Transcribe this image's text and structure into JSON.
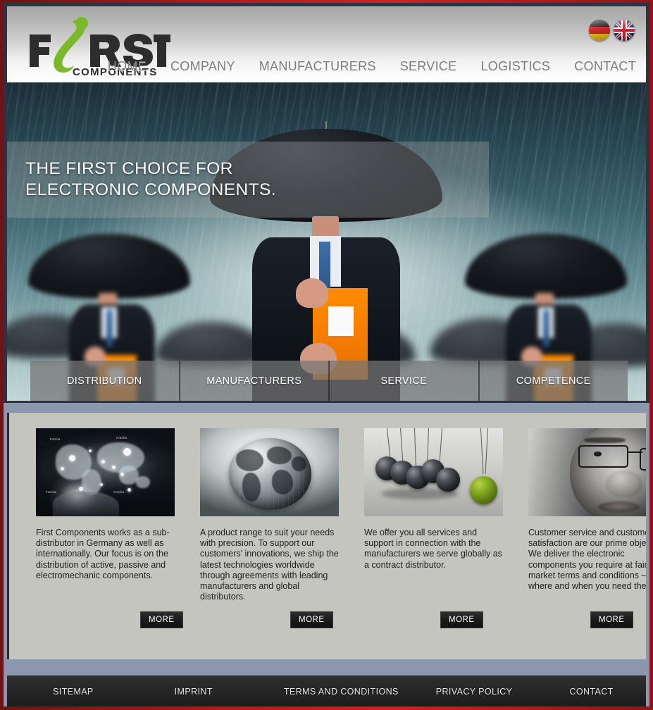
{
  "site": {
    "logo_main": "FIRST",
    "logo_sub": "COMPONENTS",
    "accent_green": "#7ab929",
    "frame_red": "#b31b1b",
    "hero_band_gray": "#aaaeac",
    "content_bg": "#c5c5bf",
    "footer_bg": "#242424",
    "page_bg_blue": "#8a97ad"
  },
  "language_flags": [
    {
      "name": "german-flag",
      "label": "Deutsch",
      "code": "de"
    },
    {
      "name": "english-flag",
      "label": "English",
      "code": "en"
    }
  ],
  "nav": {
    "items": [
      {
        "label": "HOME"
      },
      {
        "label": "COMPANY"
      },
      {
        "label": "MANUFACTURERS"
      },
      {
        "label": "SERVICE"
      },
      {
        "label": "LOGISTICS"
      },
      {
        "label": "CONTACT"
      }
    ]
  },
  "hero": {
    "headline_line1": "THE FIRST CHOICE FOR",
    "headline_line2": "ELECTRONIC COMPONENTS.",
    "categories": [
      {
        "label": "DISTRIBUTION"
      },
      {
        "label": "MANUFACTURERS"
      },
      {
        "label": "SERVICE"
      },
      {
        "label": "COMPETENCE"
      }
    ]
  },
  "cards": [
    {
      "thumb": "world-map-hologram-image",
      "text": "First Components works as a sub-distributor in Germany as well as internationally. Our focus is on the distribution of active, passive and electromechanic components.",
      "more_label": "MORE"
    },
    {
      "thumb": "metallic-globe-image",
      "text": "A product range to suit your needs with precision. To support our customers’ innovations, we ship the latest technologies worldwide through agreements with leading manufacturers and global distributors.",
      "more_label": "MORE"
    },
    {
      "thumb": "newtons-cradle-image",
      "text": "We offer you all services and support in connection with the manufacturers we serve globally as a contract distributor.",
      "more_label": "MORE"
    },
    {
      "thumb": "man-with-glasses-portrait-image",
      "text": "Customer service and customer satisfaction are our prime objective. We deliver the electronic components you require at fair market terms and conditions – where and when you need them.",
      "more_label": "MORE"
    }
  ],
  "footer": {
    "items": [
      {
        "label": "SITEMAP"
      },
      {
        "label": "IMPRINT"
      },
      {
        "label": "TERMS AND CONDITIONS"
      },
      {
        "label": "PRIVACY POLICY"
      },
      {
        "label": "CONTACT"
      }
    ]
  },
  "map_labels": [
    "Fotolia",
    "Fotolia",
    "Fotolia",
    "Fotolia"
  ]
}
